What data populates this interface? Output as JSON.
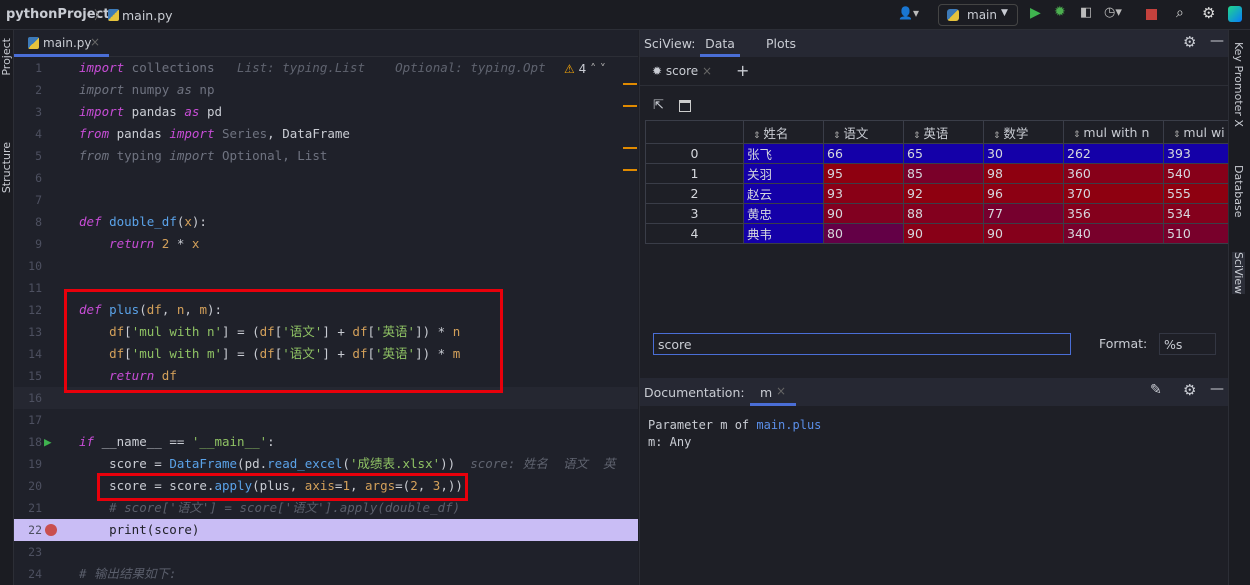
{
  "breadcrumb": {
    "project": "pythonProject",
    "file": "main.py"
  },
  "toolbar": {
    "run_config": "main"
  },
  "left_strip": {
    "project": "Project",
    "structure": "Structure"
  },
  "right_strip": {
    "key_promoter": "Key Promoter X",
    "database": "Database",
    "sciview": "SciView"
  },
  "editor": {
    "tab": "main.py",
    "warnings_count": "4",
    "lines": [
      [
        [
          "import",
          "kw"
        ],
        [
          " collections",
          "dim"
        ],
        [
          "   List: typing.List    Optional: typing.Opt",
          "hint"
        ]
      ],
      [
        [
          "import",
          "dimi"
        ],
        [
          " numpy ",
          "dim"
        ],
        [
          "as",
          "dimi"
        ],
        [
          " np",
          "dim"
        ]
      ],
      [
        [
          "import",
          "kw"
        ],
        [
          " pandas ",
          "pl"
        ],
        [
          "as",
          "kw"
        ],
        [
          " pd",
          "pl"
        ]
      ],
      [
        [
          "from",
          "kw"
        ],
        [
          " pandas ",
          "pl"
        ],
        [
          "import",
          "kw"
        ],
        [
          " Series",
          "dim"
        ],
        [
          ", DataFrame",
          "pl"
        ]
      ],
      [
        [
          "from",
          "dimi"
        ],
        [
          " typing ",
          "dim"
        ],
        [
          "import",
          "dimi"
        ],
        [
          " Optional, List",
          "dim"
        ]
      ],
      [],
      [],
      [
        [
          "def",
          "kw"
        ],
        [
          " ",
          "pl"
        ],
        [
          "double_df",
          "fn"
        ],
        [
          "(",
          "pl"
        ],
        [
          "x",
          "par"
        ],
        [
          "):",
          "pl"
        ]
      ],
      [
        [
          "    ",
          "pl"
        ],
        [
          "return",
          "kw"
        ],
        [
          " ",
          "pl"
        ],
        [
          "2",
          "num"
        ],
        [
          " * ",
          "pl"
        ],
        [
          "x",
          "par"
        ]
      ],
      [],
      [],
      [
        [
          "def",
          "kw"
        ],
        [
          " ",
          "pl"
        ],
        [
          "plus",
          "fn"
        ],
        [
          "(",
          "pl"
        ],
        [
          "df",
          "par"
        ],
        [
          ", ",
          "pl"
        ],
        [
          "n",
          "par"
        ],
        [
          ", ",
          "pl"
        ],
        [
          "m",
          "par"
        ],
        [
          "):",
          "pl"
        ]
      ],
      [
        [
          "    ",
          "pl"
        ],
        [
          "df",
          "par"
        ],
        [
          "[",
          "pl"
        ],
        [
          "'mul with n'",
          "str"
        ],
        [
          "] = (",
          "pl"
        ],
        [
          "df",
          "par"
        ],
        [
          "[",
          "pl"
        ],
        [
          "'语文'",
          "str"
        ],
        [
          "] + ",
          "pl"
        ],
        [
          "df",
          "par"
        ],
        [
          "[",
          "pl"
        ],
        [
          "'英语'",
          "str"
        ],
        [
          "]) * ",
          "pl"
        ],
        [
          "n",
          "par"
        ]
      ],
      [
        [
          "    ",
          "pl"
        ],
        [
          "df",
          "par"
        ],
        [
          "[",
          "pl"
        ],
        [
          "'mul with m'",
          "str"
        ],
        [
          "] = (",
          "pl"
        ],
        [
          "df",
          "par"
        ],
        [
          "[",
          "pl"
        ],
        [
          "'语文'",
          "str"
        ],
        [
          "] + ",
          "pl"
        ],
        [
          "df",
          "par"
        ],
        [
          "[",
          "pl"
        ],
        [
          "'英语'",
          "str"
        ],
        [
          "]) * ",
          "pl"
        ],
        [
          "m",
          "par"
        ]
      ],
      [
        [
          "    ",
          "pl"
        ],
        [
          "return",
          "kw"
        ],
        [
          " ",
          "pl"
        ],
        [
          "df",
          "par"
        ]
      ],
      [],
      [],
      [
        [
          "if",
          "kw"
        ],
        [
          " __name__ == ",
          "pl"
        ],
        [
          "'__main__'",
          "str"
        ],
        [
          ":",
          "pl"
        ]
      ],
      [
        [
          "    score = ",
          "pl"
        ],
        [
          "DataFrame",
          "fn"
        ],
        [
          "(pd.",
          "pl"
        ],
        [
          "read_excel",
          "fn"
        ],
        [
          "(",
          "pl"
        ],
        [
          "'成绩表.xlsx'",
          "str"
        ],
        [
          "))",
          "pl"
        ],
        [
          "  score: 姓名  语文  英",
          "hint"
        ]
      ],
      [
        [
          "    score = score.",
          "pl"
        ],
        [
          "apply",
          "fn"
        ],
        [
          "(plus, ",
          "pl"
        ],
        [
          "axis",
          "par"
        ],
        [
          "=",
          "pl"
        ],
        [
          "1",
          "num"
        ],
        [
          ", ",
          "pl"
        ],
        [
          "args",
          "par"
        ],
        [
          "=(",
          "pl"
        ],
        [
          "2",
          "num"
        ],
        [
          ", ",
          "pl"
        ],
        [
          "3",
          "num"
        ],
        [
          ",))",
          "pl"
        ]
      ],
      [
        [
          "    # score['语文'] = score['语文'].apply(double_df)",
          "cm"
        ]
      ],
      [
        [
          "    print(score)",
          "pl"
        ]
      ],
      [],
      [
        [
          "# 输出结果如下:",
          "cm"
        ]
      ]
    ]
  },
  "sciview": {
    "label": "SciView:",
    "tabs": [
      "Data",
      "Plots"
    ],
    "active_tab": "Data",
    "var_tab": "score",
    "columns": [
      "",
      "姓名",
      "语文",
      "英语",
      "数学",
      "mul with n",
      "mul wi"
    ],
    "rows": [
      [
        "0",
        "张飞",
        "66",
        "65",
        "30",
        "262",
        "393"
      ],
      [
        "1",
        "关羽",
        "95",
        "85",
        "98",
        "360",
        "540"
      ],
      [
        "2",
        "赵云",
        "93",
        "92",
        "96",
        "370",
        "555"
      ],
      [
        "3",
        "黄忠",
        "90",
        "88",
        "77",
        "356",
        "534"
      ],
      [
        "4",
        "典韦",
        "80",
        "90",
        "90",
        "340",
        "510"
      ]
    ],
    "heat_colors": {
      "low": "#1400a8",
      "high": "#8e0010",
      "name_col": "#1400a8"
    },
    "expression": "score",
    "format_label": "Format:",
    "format_value": "%s"
  },
  "documentation": {
    "label": "Documentation:",
    "tab": "m",
    "line1_prefix": "Parameter m of ",
    "line1_link": "main.plus",
    "line2": "m: Any"
  },
  "colors": {
    "highlight_box": "#e8000b",
    "exec_line": "#c9bdf5",
    "accent": "#4a6ed6"
  }
}
